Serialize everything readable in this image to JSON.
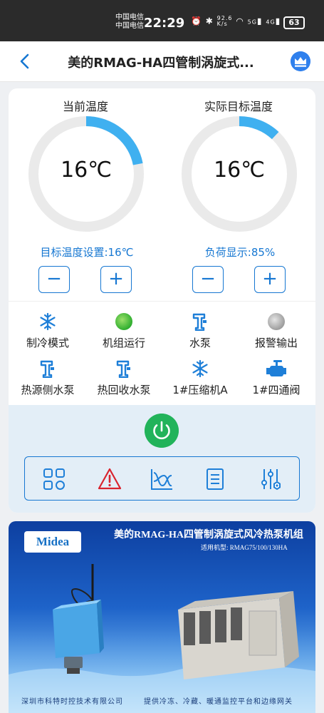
{
  "status_bar": {
    "carrier_1": "中国电信",
    "carrier_2": "中国电信",
    "time": "22:29",
    "net_speed_value": "92.6",
    "net_speed_unit": "K/s",
    "signal_1": "5G",
    "signal_2": "4G",
    "battery": "63"
  },
  "nav": {
    "title": "美的RMAG-HA四管制涡旋式..."
  },
  "gauges": {
    "current": {
      "label": "当前温度",
      "value": "16℃",
      "fill_fraction": 0.22
    },
    "target": {
      "label": "实际目标温度",
      "value": "16℃",
      "fill_fraction": 0.12
    }
  },
  "settings": {
    "target_setpoint": "目标温度设置:16℃",
    "load_display": "负荷显示:85%",
    "minus": "−",
    "plus": "+"
  },
  "status_items": [
    {
      "label": "制冷模式",
      "icon": "snowflake-icon"
    },
    {
      "label": "机组运行",
      "icon": "green-indicator-icon"
    },
    {
      "label": "水泵",
      "icon": "pump-icon"
    },
    {
      "label": "报警输出",
      "icon": "gray-indicator-icon"
    },
    {
      "label": "热源侧水泵",
      "icon": "pump-icon"
    },
    {
      "label": "热回收水泵",
      "icon": "pump-icon"
    },
    {
      "label": "1#压缩机A",
      "icon": "snowflake-icon"
    },
    {
      "label": "1#四通阀",
      "icon": "valve-icon"
    }
  ],
  "toolbar": [
    "dashboard-icon",
    "alarm-icon",
    "chart-icon",
    "list-icon",
    "settings-sliders-icon"
  ],
  "banner": {
    "logo": "Midea",
    "title": "美的RMAG-HA四管制涡旋式风冷热泵机组",
    "subtitle": "适用机型: RMAG75/100/130HA",
    "footer_left": "深圳市科特时控技术有限公司",
    "footer_right": "提供冷冻、冷藏、暖通监控平台和边缘网关"
  },
  "colors": {
    "accent": "#1677d2",
    "gauge_fill": "#3fb0f0",
    "power": "#22b35a"
  }
}
